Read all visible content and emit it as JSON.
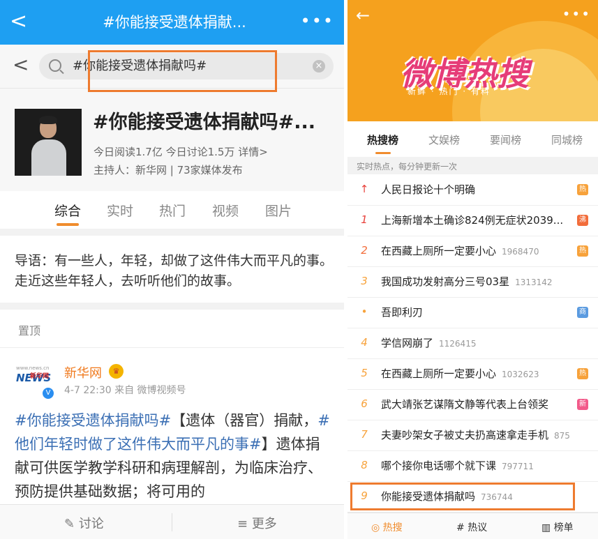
{
  "left": {
    "header": {
      "back": "<",
      "title": "#你能接受遗体捐献...",
      "more": "•••"
    },
    "search": {
      "back": "<",
      "query": "#你能接受遗体捐献吗#",
      "clear": "×"
    },
    "topic": {
      "title": "#你能接受遗体捐献吗#...",
      "stats": "今日阅读1.7亿 今日讨论1.5万 详情>",
      "host": "主持人：新华网 | 73家媒体发布"
    },
    "tabs": [
      "综合",
      "实时",
      "热门",
      "视频",
      "图片"
    ],
    "intro": "导语：有一些人，年轻，却做了这件伟大而平凡的事。走近这些年轻人，去听听他们的故事。",
    "pinned_label": "置顶",
    "post": {
      "logo_small": "www.news.cn",
      "logo_main": "NEWS",
      "logo_cn": "新华网",
      "username": "新华网",
      "time_source": "4-7 22:30 来自 微博视频号",
      "tag1": "#你能接受遗体捐献吗#",
      "text1": "【遗体（器官）捐献，",
      "tag2": "#他们年轻时做了这件伟大而平凡的事#",
      "text2": "】遗体捐献可供医学教学科研和病理解剖，为临床治疗、预防提供基础数据；将可用的"
    },
    "bottom": {
      "discuss": "讨论",
      "more": "更多"
    }
  },
  "right": {
    "banner": {
      "back": "←",
      "more": "•••",
      "title": "微博热搜",
      "subtitle": "新鲜 · 热门 · 有料"
    },
    "tabs": [
      "热搜榜",
      "文娱榜",
      "要闻榜",
      "同城榜"
    ],
    "subtitle": "实时热点，每分钟更新一次",
    "items": [
      {
        "rank": "↑",
        "text": "人民日报论十个明确",
        "count": "",
        "badge": "热",
        "badge_color": "#f7a23b",
        "rank_color": "#e8413b"
      },
      {
        "rank": "1",
        "text": "上海新增本土确诊824例无症状2039...",
        "count": "",
        "badge": "沸",
        "badge_color": "#f26d3b",
        "rank_color": "#e8413b"
      },
      {
        "rank": "2",
        "text": "在西藏上厕所一定要小心",
        "count": "1968470",
        "badge": "热",
        "badge_color": "#f7a23b",
        "rank_color": "#f26d3b"
      },
      {
        "rank": "3",
        "text": "我国成功发射高分三号03星",
        "count": "1313142",
        "badge": "",
        "badge_color": "",
        "rank_color": "#f7a23b"
      },
      {
        "rank": "•",
        "text": "吾即利刃",
        "count": "",
        "badge": "商",
        "badge_color": "#5b9be0",
        "rank_color": "#f7a23b"
      },
      {
        "rank": "4",
        "text": "学信网崩了",
        "count": "1126415",
        "badge": "",
        "badge_color": "",
        "rank_color": "#f7a23b"
      },
      {
        "rank": "5",
        "text": "在西藏上厕所一定要小心",
        "count": "1032623",
        "badge": "热",
        "badge_color": "#f7a23b",
        "rank_color": "#f7a23b"
      },
      {
        "rank": "6",
        "text": "武大靖张艺谋隋文静等代表上台领奖",
        "count": "",
        "badge": "新",
        "badge_color": "#f25a8a",
        "rank_color": "#f7a23b"
      },
      {
        "rank": "7",
        "text": "夫妻吵架女子被丈夫扔高速拿走手机",
        "count": "8757...",
        "badge": "",
        "badge_color": "",
        "rank_color": "#f7a23b"
      },
      {
        "rank": "8",
        "text": "哪个接你电话哪个就下课",
        "count": "797711",
        "badge": "",
        "badge_color": "",
        "rank_color": "#f7a23b"
      },
      {
        "rank": "9",
        "text": "你能接受遗体捐献吗",
        "count": "736744",
        "badge": "",
        "badge_color": "",
        "rank_color": "#f7a23b"
      }
    ],
    "bottom": {
      "hot": "热搜",
      "discuss": "热议",
      "board": "榜单"
    }
  }
}
